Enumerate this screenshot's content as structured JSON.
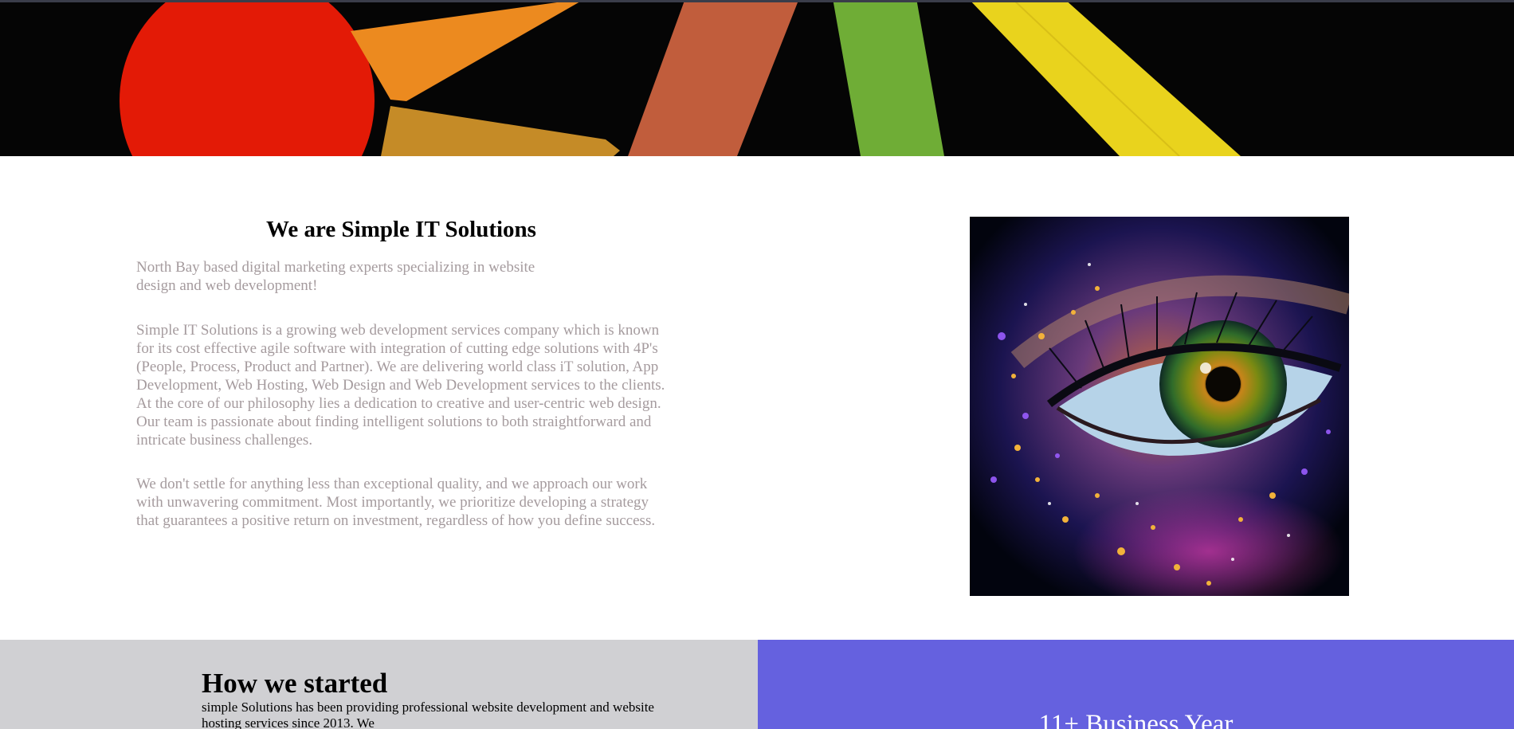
{
  "about": {
    "title": "We are Simple IT Solutions",
    "tagline": "North Bay based digital marketing experts specializing in website design and web development!",
    "paragraph_1": "Simple IT Solutions is a growing web development services company which is known for its cost effective agile software with integration of cutting edge solutions with 4P's (People, Process, Product and Partner). We are delivering world class iT solution, App Development, Web Hosting, Web Design and Web Development services to the clients. At the core of our philosophy lies a dedication to creative and user-centric web design. Our team is passionate about finding intelligent solutions to both straightforward and intricate business challenges.",
    "paragraph_2": "We don't settle for anything less than exceptional quality, and we approach our work with unwavering commitment. Most importantly, we prioritize developing a strategy that guarantees a positive return on investment, regardless of how you define success."
  },
  "how_we_started": {
    "title": "How we started",
    "text": "simple Solutions has been providing professional website development and website hosting services since 2013. We"
  },
  "stats": {
    "label": "11+ Business Year"
  },
  "colors": {
    "banner_bg": "#050505",
    "body_text_muted": "#a59b9e",
    "started_bg": "#d0d0d3",
    "stats_bg": "#6561df"
  }
}
